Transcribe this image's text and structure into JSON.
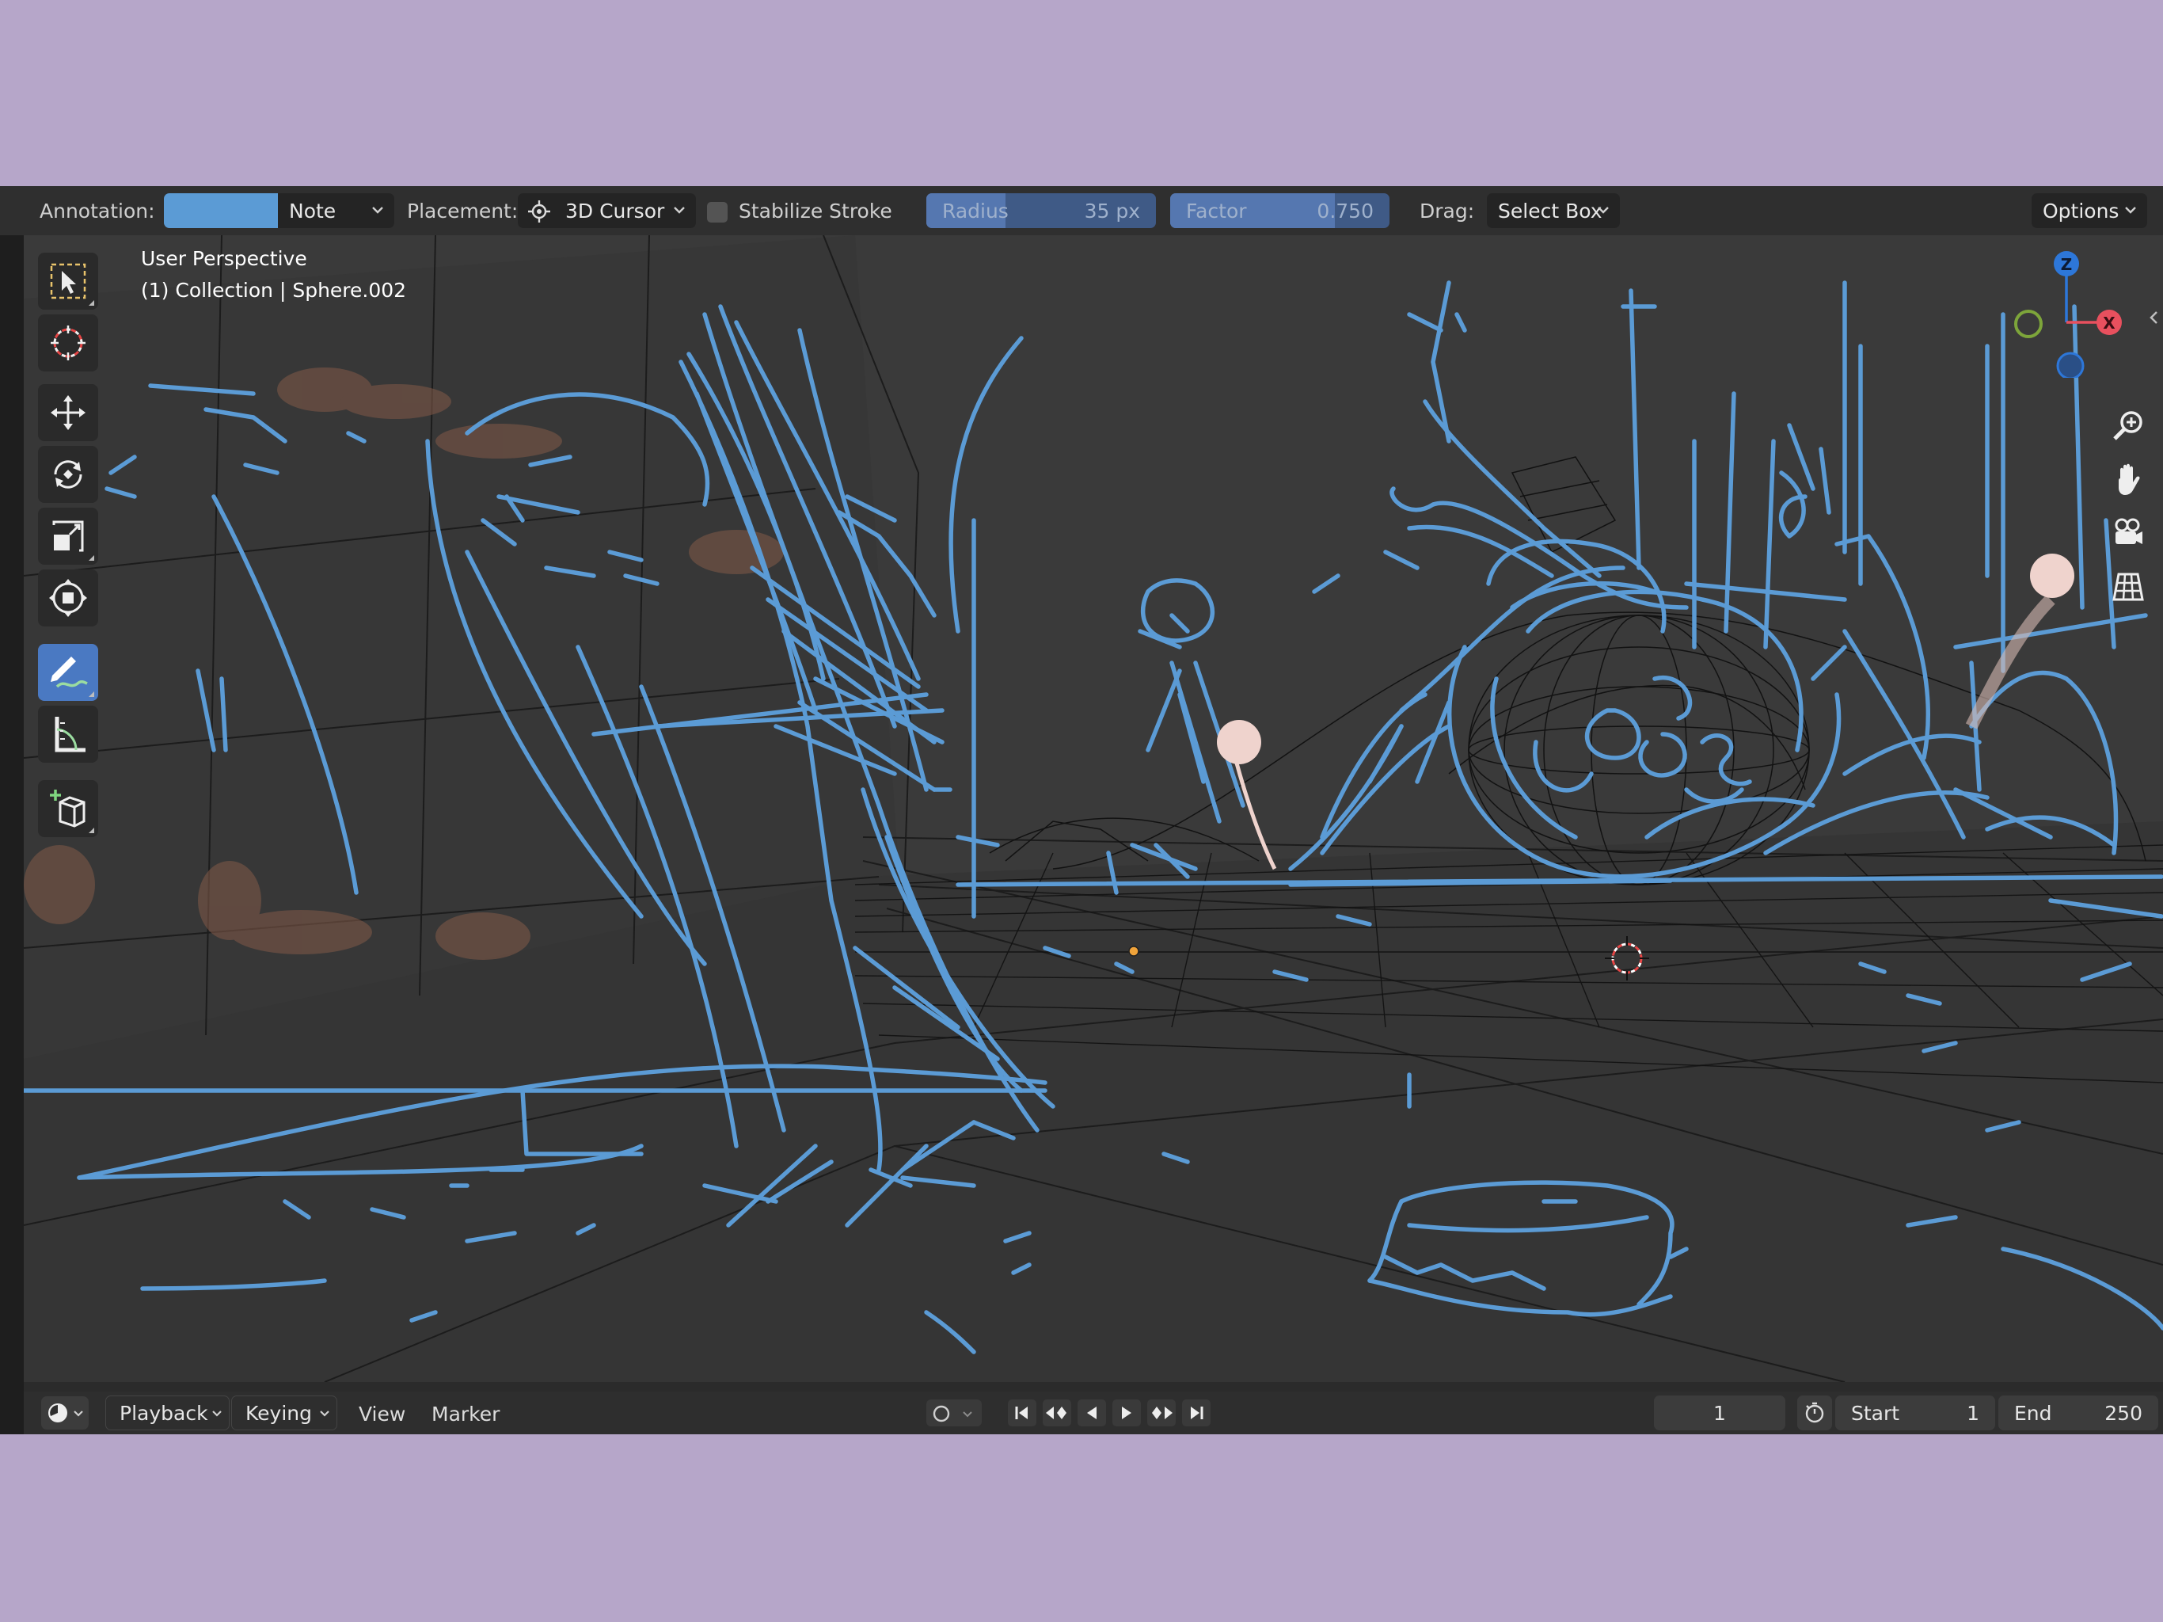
{
  "header": {
    "annotation_label": "Annotation:",
    "annotation_color": "#5b9bd5",
    "annotation_layer": "Note",
    "placement_label": "Placement:",
    "placement_icon": "cursor-target-icon",
    "placement_value": "3D Cursor",
    "stabilize_label": "Stabilize Stroke",
    "stabilize_checked": false,
    "radius_label": "Radius",
    "radius_value": "35 px",
    "factor_label": "Factor",
    "factor_value": "0.750",
    "drag_label": "Drag:",
    "drag_value": "Select Box",
    "options_label": "Options"
  },
  "viewport": {
    "perspective": "User Perspective",
    "collection": "(1) Collection | Sphere.002",
    "gizmo": {
      "z": "Z",
      "x": "X",
      "x_color": "#e8505e",
      "z_color": "#2d77d9",
      "y_color": "#7da53a"
    },
    "annotation_stroke_color": "#5b9bd5",
    "tools": [
      "select-box-icon",
      "cursor-icon",
      "move-icon",
      "rotate-icon",
      "scale-icon",
      "transform-icon",
      "annotate-icon",
      "measure-icon",
      "add-cube-icon"
    ],
    "active_tool": "annotate-icon",
    "nav": [
      "zoom-icon",
      "pan-hand-icon",
      "camera-icon",
      "grid-view-icon"
    ]
  },
  "timeline": {
    "editor_icon": "clock-icon",
    "playback": "Playback",
    "keying": "Keying",
    "view": "View",
    "marker": "Marker",
    "current_frame": "1",
    "start_label": "Start",
    "start_value": "1",
    "end_label": "End",
    "end_value": "250"
  }
}
